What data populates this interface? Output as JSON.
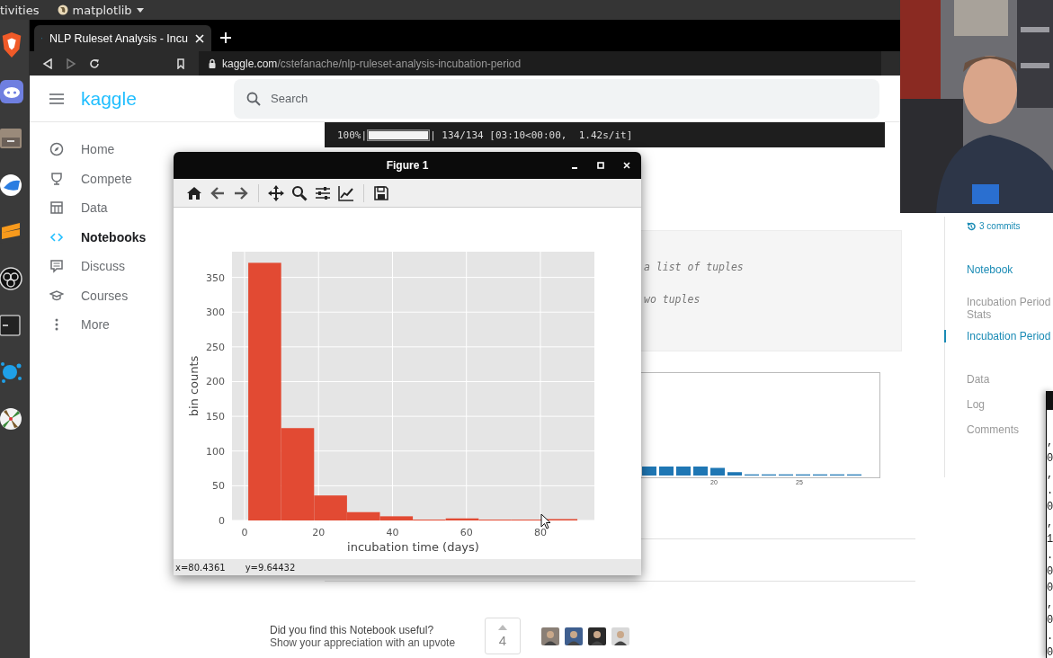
{
  "top_bar": {
    "activities": "tivities",
    "app_menu": "matplotlib"
  },
  "browser": {
    "tab": {
      "title": "NLP Ruleset Analysis - Incu"
    },
    "url_host": "kaggle.com",
    "url_path": "/cstefanache/nlp-ruleset-analysis-incubation-period"
  },
  "kaggle": {
    "logo": "kaggle",
    "search": {
      "placeholder": "Search"
    },
    "nav": [
      {
        "kind": "home",
        "label": "Home",
        "selected": false
      },
      {
        "kind": "compete",
        "label": "Compete",
        "selected": false
      },
      {
        "kind": "data",
        "label": "Data",
        "selected": false
      },
      {
        "kind": "notebooks",
        "label": "Notebooks",
        "selected": true
      },
      {
        "kind": "discuss",
        "label": "Discuss",
        "selected": false
      },
      {
        "kind": "courses",
        "label": "Courses",
        "selected": false
      },
      {
        "kind": "more",
        "label": "More",
        "selected": false
      }
    ],
    "output": {
      "percent": "100%|",
      "progress": {
        "level": 1
      },
      "stats": "| 134/134 [03:10<00:00,  1.42s/it]"
    },
    "code_lines": [
      "a list of tuples",
      "wo tuples"
    ],
    "output_chart": {
      "tick_labels": [
        "20",
        "25"
      ]
    },
    "toc": {
      "commits": "3 commits",
      "items": [
        {
          "kind": "tab",
          "label": "Notebook",
          "selected": true
        },
        {
          "kind": "heading",
          "label": "Incubation Period Stats",
          "selected": false
        },
        {
          "kind": "heading",
          "label": "Incubation Period",
          "selected": true
        },
        {
          "kind": "tab",
          "label": "Data",
          "selected": false
        },
        {
          "kind": "tab",
          "label": "Log",
          "selected": false
        },
        {
          "kind": "tab",
          "label": "Comments",
          "selected": false
        }
      ]
    },
    "upvote": {
      "question": "Did you find this Notebook useful?",
      "prompt": "Show your appreciation with an upvote",
      "count": "4",
      "voters": [
        {
          "kind": "avatar"
        },
        {
          "kind": "avatar"
        },
        {
          "kind": "avatar"
        },
        {
          "kind": "avatar"
        }
      ]
    }
  },
  "figure": {
    "title": "Figure 1",
    "status_x": "x=80.4361",
    "status_y": "y=9.64432",
    "chart_data": {
      "type": "bar",
      "xlabel": "incubation time (days)",
      "ylabel": "bin counts",
      "x": [
        5.45,
        14.35,
        23.25,
        32.15,
        41.05,
        49.95,
        58.85,
        67.75,
        76.65,
        85.55
      ],
      "values": [
        371,
        133,
        36,
        12,
        6,
        1,
        3,
        0,
        0,
        2
      ],
      "grid": true,
      "xlim": [
        -3.4,
        94.6
      ],
      "ylim": [
        0,
        387
      ],
      "xticks": [
        0,
        20,
        40,
        60,
        80
      ],
      "yticks": [
        0,
        50,
        100,
        150,
        200,
        250,
        300,
        350
      ]
    }
  },
  "terminal": {
    "lines": [
      ",",
      "0",
      ",",
      ".",
      "0",
      ",",
      "1",
      ".",
      "0",
      "0",
      ",",
      "0",
      ".",
      "0"
    ]
  }
}
